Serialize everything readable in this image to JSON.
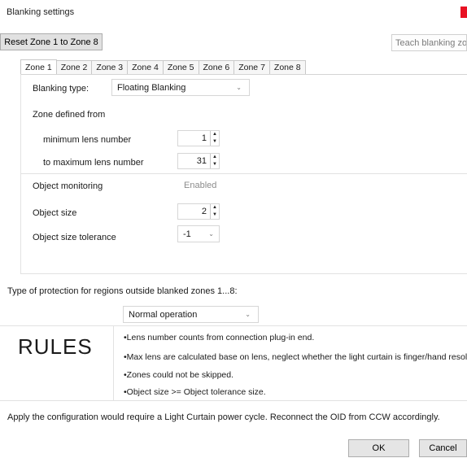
{
  "window": {
    "title": "Blanking settings"
  },
  "toolbar": {
    "reset_label": "Reset Zone 1 to Zone 8",
    "teach_label": "Teach blanking zone"
  },
  "tabs": [
    "Zone 1",
    "Zone 2",
    "Zone 3",
    "Zone 4",
    "Zone 5",
    "Zone 6",
    "Zone 7",
    "Zone 8"
  ],
  "zone": {
    "blanking_type_label": "Blanking type:",
    "blanking_type_value": "Floating Blanking",
    "zone_defined_label": "Zone defined from",
    "min_lens_label": "minimum lens number",
    "min_lens_value": "1",
    "max_lens_label": "to maximum lens number",
    "max_lens_value": "31",
    "object_monitoring_label": "Object monitoring",
    "object_monitoring_value": "Enabled",
    "object_size_label": "Object size",
    "object_size_value": "2",
    "tolerance_label": "Object size tolerance",
    "tolerance_value": "-1"
  },
  "protection": {
    "label": "Type of protection for regions outside blanked zones 1...8:",
    "value": "Normal operation"
  },
  "rules": {
    "title": "RULES",
    "items": [
      "•Lens number counts from connection plug-in end.",
      "•Max lens are calculated base on lens, neglect whether the light curtain is finger/hand resolution",
      "•Zones could not be skipped.",
      "•Object size >= Object tolerance size."
    ]
  },
  "footer": {
    "note": "Apply the configuration would require a Light Curtain power cycle.   Reconnect the OID from CCW accordingly.",
    "ok_label": "OK",
    "cancel_label": "Cancel"
  },
  "colors": {
    "close_accent": "#e81123"
  }
}
